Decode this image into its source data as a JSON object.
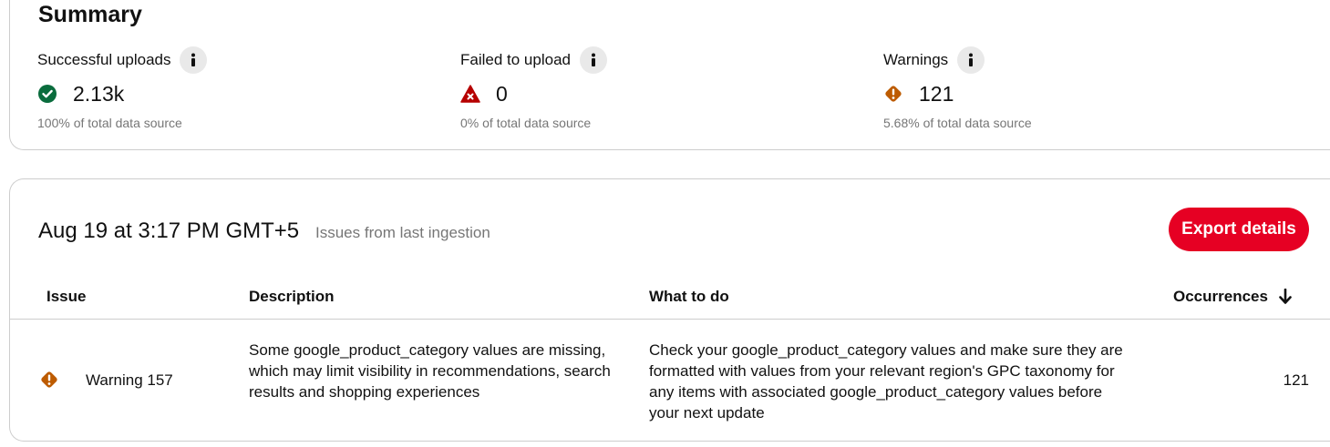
{
  "summary": {
    "title": "Summary",
    "metrics": [
      {
        "label": "Successful uploads",
        "value": "2.13k",
        "sub": "100% of total data source",
        "icon": "check-circle-icon",
        "color": "#0a6c3d"
      },
      {
        "label": "Failed to upload",
        "value": "0",
        "sub": "0% of total data source",
        "icon": "error-triangle-icon",
        "color": "#b60000"
      },
      {
        "label": "Warnings",
        "value": "121",
        "sub": "5.68% of total data source",
        "icon": "warning-diamond-icon",
        "color": "#bd5b00"
      }
    ]
  },
  "ingestion": {
    "date": "Aug 19 at 3:17 PM GMT+5",
    "subtitle": "Issues from last ingestion",
    "export_label": "Export details",
    "accent": "#e60023"
  },
  "table": {
    "headers": {
      "issue": "Issue",
      "description": "Description",
      "what_to_do": "What to do",
      "occurrences": "Occurrences"
    },
    "sort_icon": "arrow-down-icon",
    "rows": [
      {
        "icon": "warning-diamond-icon",
        "issue": "Warning 157",
        "description": "Some google_product_category values are missing, which may limit visibility in recommendations, search results and shopping experiences",
        "what_to_do": "Check your google_product_category values and make sure they are formatted with values from your relevant region's GPC taxonomy for any items with associated google_product_category values before your next update",
        "occurrences": "121"
      }
    ]
  }
}
